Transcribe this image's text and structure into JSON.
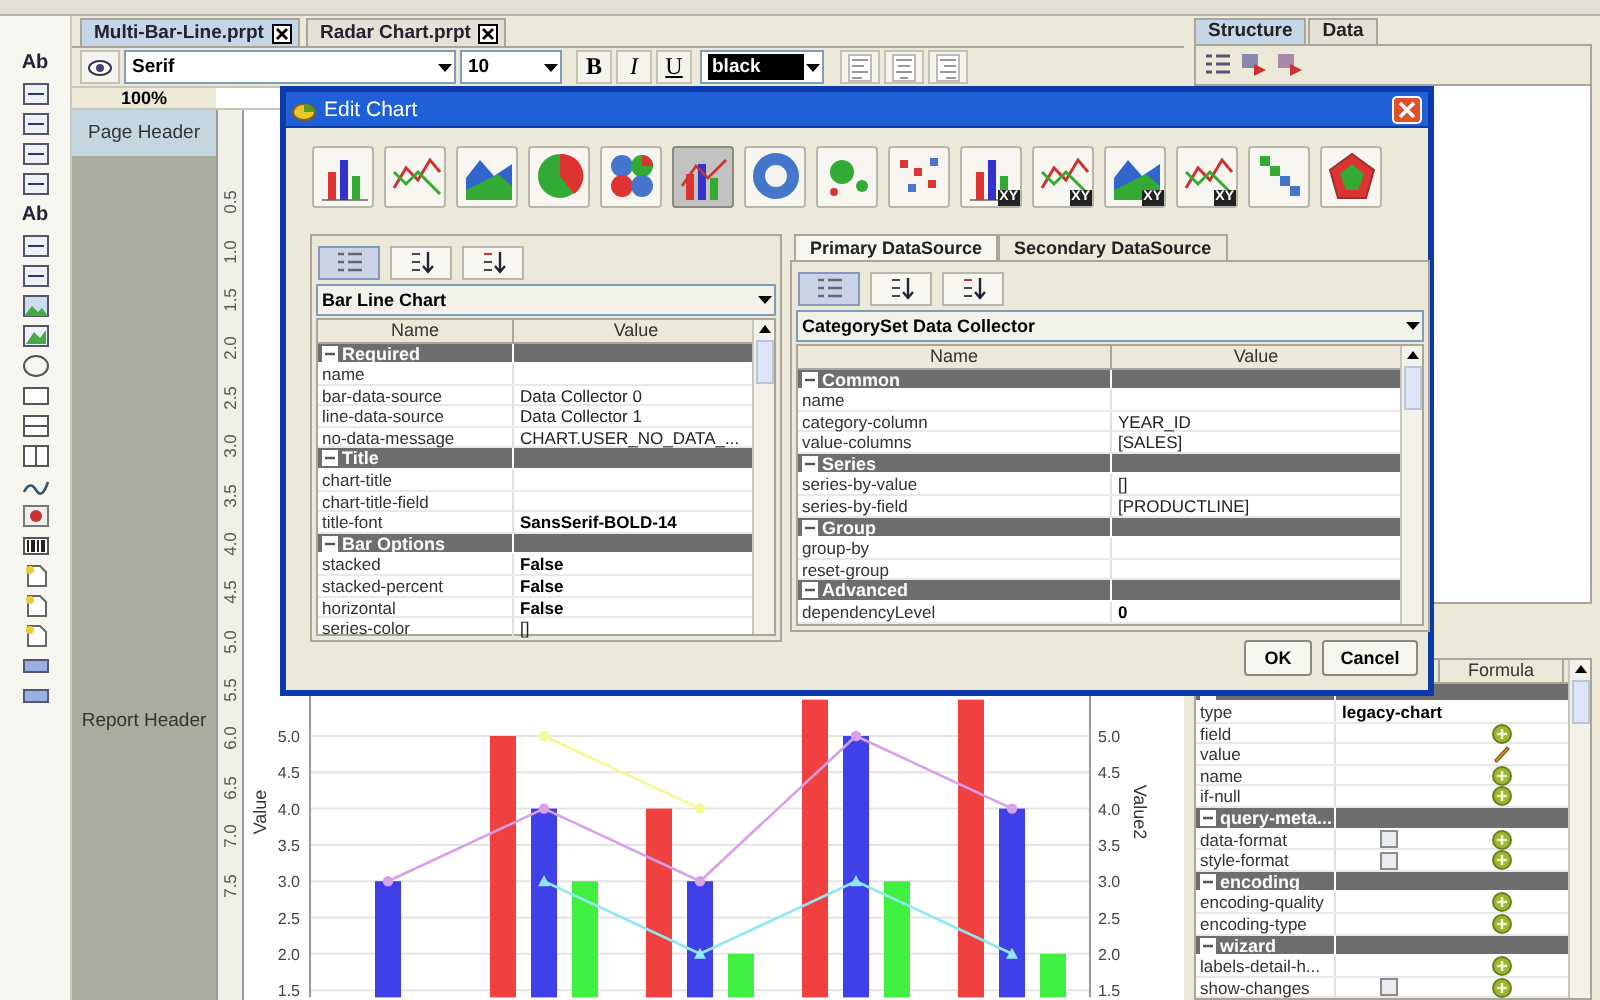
{
  "editor_tabs": [
    {
      "label": "Multi-Bar-Line.prpt",
      "selected": true
    },
    {
      "label": "Radar Chart.prpt",
      "selected": false
    }
  ],
  "palette": [
    {
      "kind": "text",
      "label": "Ab"
    },
    {
      "kind": "field"
    },
    {
      "kind": "field"
    },
    {
      "kind": "field"
    },
    {
      "kind": "field"
    },
    {
      "kind": "text",
      "label": "Ab"
    },
    {
      "kind": "field"
    },
    {
      "kind": "field"
    },
    {
      "kind": "image"
    },
    {
      "kind": "chart"
    },
    {
      "kind": "ellipse"
    },
    {
      "kind": "rect"
    },
    {
      "kind": "hline"
    },
    {
      "kind": "vline"
    },
    {
      "kind": "squiggle"
    },
    {
      "kind": "circle"
    },
    {
      "kind": "barcode"
    },
    {
      "kind": "document"
    },
    {
      "kind": "document"
    },
    {
      "kind": "document"
    },
    {
      "kind": "band"
    },
    {
      "kind": "band"
    }
  ],
  "format_toolbar": {
    "font": "Serif",
    "size": "10",
    "styles": [
      {
        "kind": "bold",
        "label": "B"
      },
      {
        "kind": "italic",
        "label": "I"
      },
      {
        "kind": "underline",
        "label": "U"
      }
    ],
    "text_color_label": "black"
  },
  "zoom": "100%",
  "bands": {
    "page_header": "Page Header",
    "report_header": "Report Header"
  },
  "vertical_ruler": [
    "0.5",
    "1.0",
    "1.5",
    "2.0",
    "2.5",
    "3.0",
    "3.5",
    "4.0",
    "4.5",
    "5.0",
    "5.5",
    "6.0",
    "6.5",
    "7.0",
    "7.5"
  ],
  "chart": {
    "chart_data": {
      "type": "bar",
      "ylabel": "Value",
      "y2label": "Value2",
      "ylim": [
        1.4,
        5.6
      ],
      "y2lim": [
        1.4,
        5.6
      ],
      "grid": true,
      "yticks": [
        {
          "value": 1.5,
          "label": "1.5"
        },
        {
          "value": 2.0,
          "label": "2.0"
        },
        {
          "value": 2.5,
          "label": "2.5"
        },
        {
          "value": 3.0,
          "label": "3.0"
        },
        {
          "value": 3.5,
          "label": "3.5"
        },
        {
          "value": 4.0,
          "label": "4.0"
        },
        {
          "value": 4.5,
          "label": "4.5"
        },
        {
          "value": 5.0,
          "label": "5.0"
        }
      ],
      "y2ticks": [
        {
          "value": 1.5,
          "label": "1.5"
        },
        {
          "value": 2.0,
          "label": "2.0"
        },
        {
          "value": 2.5,
          "label": "2.5"
        },
        {
          "value": 3.0,
          "label": "3.0"
        },
        {
          "value": 3.5,
          "label": "3.5"
        },
        {
          "value": 4.0,
          "label": "4.0"
        },
        {
          "value": 4.5,
          "label": "4.5"
        },
        {
          "value": 5.0,
          "label": "5.0"
        }
      ],
      "series": [
        {
          "type": "bar",
          "color": "#f04040",
          "values": [
            null,
            5.0,
            4.0,
            5.5,
            5.5
          ]
        },
        {
          "type": "bar",
          "color": "#4040e8",
          "values": [
            3.0,
            4.0,
            3.0,
            5.0,
            4.0
          ]
        },
        {
          "type": "bar",
          "color": "#40f040",
          "values": [
            null,
            3.0,
            2.0,
            3.0,
            2.0
          ]
        },
        {
          "type": "line",
          "color": "#f8f890",
          "marker": "circle",
          "values": [
            null,
            5.0,
            4.0,
            null,
            null
          ]
        },
        {
          "type": "line",
          "color": "#d8a0e8",
          "marker": "circle",
          "values": [
            3.0,
            4.0,
            3.0,
            5.0,
            4.0
          ]
        },
        {
          "type": "line",
          "color": "#90e8f0",
          "marker": "triangle",
          "values": [
            null,
            3.0,
            2.0,
            3.0,
            2.0
          ]
        }
      ]
    }
  },
  "right_panel": {
    "tabs": [
      {
        "label": "Structure",
        "selected": true
      },
      {
        "label": "Data",
        "selected": false
      }
    ],
    "properties": {
      "columns": [
        "Formula"
      ],
      "rows": [
        {
          "kind": "section"
        },
        {
          "kind": "text",
          "name": "type",
          "value": "legacy-chart",
          "bold": true
        },
        {
          "kind": "text",
          "name": "field",
          "formula": {
            "kind": "add"
          }
        },
        {
          "kind": "text",
          "name": "value",
          "formula": {
            "kind": "edit"
          }
        },
        {
          "kind": "text",
          "name": "name",
          "formula": {
            "kind": "add"
          }
        },
        {
          "kind": "text",
          "name": "if-null",
          "formula": {
            "kind": "add"
          }
        },
        {
          "kind": "section",
          "name": "query-meta..."
        },
        {
          "kind": "checkbox",
          "name": "data-format",
          "checked": false,
          "formula": {
            "kind": "add"
          }
        },
        {
          "kind": "checkbox",
          "name": "style-format",
          "checked": false,
          "formula": {
            "kind": "add"
          }
        },
        {
          "kind": "section",
          "name": "encoding"
        },
        {
          "kind": "text",
          "name": "encoding-quality",
          "formula": {
            "kind": "add"
          }
        },
        {
          "kind": "text",
          "name": "encoding-type",
          "formula": {
            "kind": "add"
          }
        },
        {
          "kind": "section",
          "name": "wizard"
        },
        {
          "kind": "text",
          "name": "labels-detail-h...",
          "formula": {
            "kind": "add"
          }
        },
        {
          "kind": "checkbox",
          "name": "show-changes",
          "checked": false,
          "formula": {
            "kind": "add"
          }
        }
      ]
    }
  },
  "dialog": {
    "title": "Edit Chart",
    "chart_types": [
      {
        "kind": "bar",
        "selected": false
      },
      {
        "kind": "line",
        "selected": false
      },
      {
        "kind": "area",
        "selected": false
      },
      {
        "kind": "pie",
        "selected": false
      },
      {
        "kind": "multipie",
        "selected": false
      },
      {
        "kind": "barline",
        "selected": true
      },
      {
        "kind": "ring",
        "selected": false
      },
      {
        "kind": "bubble",
        "selected": false
      },
      {
        "kind": "scatter",
        "selected": false
      },
      {
        "kind": "bar",
        "badge": "XY",
        "selected": false
      },
      {
        "kind": "line",
        "badge": "XY",
        "selected": false
      },
      {
        "kind": "area",
        "badge": "XY",
        "selected": false
      },
      {
        "kind": "line",
        "badge": "XY",
        "selected": false
      },
      {
        "kind": "waterfall",
        "selected": false
      },
      {
        "kind": "radar",
        "selected": false
      }
    ],
    "chart_panel": {
      "view_buttons": [
        {
          "kind": "categorized",
          "selected": true
        },
        {
          "kind": "sort-ascending",
          "selected": false
        },
        {
          "kind": "sort-descending",
          "selected": false
        }
      ],
      "chart": "Bar Line Chart",
      "columns": [
        "Name",
        "Value"
      ],
      "rows": [
        {
          "kind": "section",
          "name": "Required"
        },
        {
          "kind": "text",
          "name": "name"
        },
        {
          "kind": "text",
          "name": "bar-data-source",
          "value": "Data Collector 0",
          "bold": false
        },
        {
          "kind": "text",
          "name": "line-data-source",
          "value": "Data Collector 1",
          "bold": false
        },
        {
          "kind": "text",
          "name": "no-data-message",
          "value": "CHART.USER_NO_DATA_...",
          "bold": false
        },
        {
          "kind": "section",
          "name": "Title"
        },
        {
          "kind": "text",
          "name": "chart-title"
        },
        {
          "kind": "text",
          "name": "chart-title-field"
        },
        {
          "kind": "text",
          "name": "title-font",
          "value": "SansSerif-BOLD-14",
          "bold": true
        },
        {
          "kind": "section",
          "name": "Bar Options"
        },
        {
          "kind": "text",
          "name": "stacked",
          "value": "False",
          "bold": true
        },
        {
          "kind": "text",
          "name": "stacked-percent",
          "value": "False",
          "bold": true
        },
        {
          "kind": "text",
          "name": "horizontal",
          "value": "False",
          "bold": true
        },
        {
          "kind": "text",
          "name": "series-color",
          "value": "[]",
          "bold": false
        }
      ]
    },
    "datasource_tabs": [
      {
        "label": "Primary DataSource",
        "selected": true
      },
      {
        "label": "Secondary DataSource",
        "selected": false
      }
    ],
    "datasource_panel": {
      "view_buttons": [
        {
          "kind": "categorized",
          "selected": true
        },
        {
          "kind": "sort-ascending",
          "selected": false
        },
        {
          "kind": "sort-descending",
          "selected": false
        }
      ],
      "collector": "CategorySet Data Collector",
      "columns": [
        "Name",
        "Value"
      ],
      "rows": [
        {
          "kind": "section",
          "name": "Common"
        },
        {
          "kind": "text",
          "name": "name"
        },
        {
          "kind": "text",
          "name": "category-column",
          "value": "YEAR_ID",
          "bold": false
        },
        {
          "kind": "text",
          "name": "value-columns",
          "value": "[SALES]",
          "bold": false
        },
        {
          "kind": "section",
          "name": "Series"
        },
        {
          "kind": "text",
          "name": "series-by-value",
          "value": "[]",
          "bold": false
        },
        {
          "kind": "text",
          "name": "series-by-field",
          "value": "[PRODUCTLINE]",
          "bold": false
        },
        {
          "kind": "section",
          "name": "Group"
        },
        {
          "kind": "text",
          "name": "group-by"
        },
        {
          "kind": "text",
          "name": "reset-group"
        },
        {
          "kind": "section",
          "name": "Advanced"
        },
        {
          "kind": "text",
          "name": "dependencyLevel",
          "value": "0",
          "bold": true
        }
      ]
    },
    "buttons": [
      "OK",
      "Cancel"
    ]
  }
}
